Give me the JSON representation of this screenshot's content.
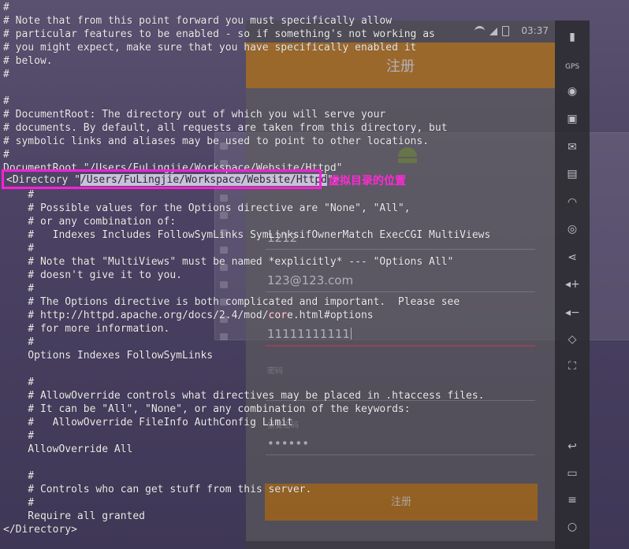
{
  "terminal": {
    "lines": [
      "#",
      "# Note that from this point forward you must specifically allow",
      "# particular features to be enabled - so if something's not working as",
      "# you might expect, make sure that you have specifically enabled it",
      "# below.",
      "#",
      "",
      "#",
      "# DocumentRoot: The directory out of which you will serve your",
      "# documents. By default, all requests are taken from this directory, but",
      "# symbolic links and aliases may be used to point to other locations.",
      "#",
      "DocumentRoot \"/Users/FuLingjie/Workspace/Website/Httpd\"",
      "",
      "    #",
      "    # Possible values for the Options directive are \"None\", \"All\",",
      "    # or any combination of:",
      "    #   Indexes Includes FollowSymLinks SymLinksifOwnerMatch ExecCGI MultiViews",
      "    #",
      "    # Note that \"MultiViews\" must be named *explicitly* --- \"Options All\"",
      "    # doesn't give it to you.",
      "    #",
      "    # The Options directive is both complicated and important.  Please see",
      "    # http://httpd.apache.org/docs/2.4/mod/core.html#options",
      "    # for more information.",
      "    #",
      "    Options Indexes FollowSymLinks",
      "",
      "    #",
      "    # AllowOverride controls what directives may be placed in .htaccess files.",
      "    # It can be \"All\", \"None\", or any combination of the keywords:",
      "    #   AllowOverride FileInfo AuthConfig Limit",
      "    #",
      "    AllowOverride All",
      "",
      "    #",
      "    # Controls who can get stuff from this server.",
      "    #",
      "    Require all granted",
      "</Directory>"
    ],
    "directory_line": {
      "prefix": "<Directory \"",
      "selected_path": "/Users/FuLingjie/Workspace/Website/Httpd",
      "suffix": "\">"
    }
  },
  "annotation": {
    "label": "虚拟目录的位置",
    "color": "#ff1fd8"
  },
  "emulator": {
    "status_time": "03:37",
    "app_title": "注册",
    "fields": [
      {
        "label": "",
        "value": "1212",
        "active": false
      },
      {
        "label": "",
        "value": "123@123.com",
        "active": false
      },
      {
        "label": "手机号",
        "value": "11111111111",
        "active": true
      },
      {
        "label": "密码",
        "value": "",
        "active": false
      },
      {
        "label": "重复密码",
        "value": "••••••",
        "active": false
      }
    ],
    "register_button": "注册",
    "accent_color": "#c67a05"
  },
  "toolbar": {
    "icons": [
      "battery-icon",
      "gps-icon",
      "camera-icon",
      "phone-icon",
      "sms-icon",
      "media-icon",
      "rss-icon",
      "fingerprint-icon",
      "share-icon",
      "volume-up-icon",
      "volume-down-icon",
      "rotate-icon",
      "fullscreen-icon",
      "back-icon",
      "recents-icon",
      "menu-icon",
      "home-icon"
    ],
    "gps_label": "GPS"
  }
}
